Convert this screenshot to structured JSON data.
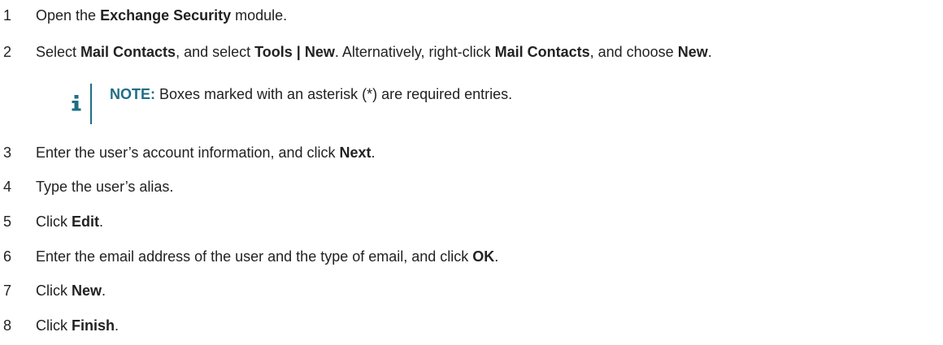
{
  "steps": [
    {
      "n": "1",
      "parts": [
        "Open the ",
        "Exchange Security",
        " module."
      ]
    },
    {
      "n": "2",
      "parts": [
        "Select ",
        "Mail Contacts",
        ", and select ",
        "Tools | New",
        ". Alternatively, right-click ",
        "Mail Contacts",
        ", and choose ",
        "New",
        "."
      ]
    },
    {
      "n": "3",
      "parts": [
        "Enter the user’s account information, and click ",
        "Next",
        "."
      ]
    },
    {
      "n": "4",
      "parts": [
        "Type the user’s alias."
      ]
    },
    {
      "n": "5",
      "parts": [
        "Click ",
        "Edit",
        "."
      ]
    },
    {
      "n": "6",
      "parts": [
        "Enter the email address of the user and the type of email, and click ",
        "OK",
        "."
      ]
    },
    {
      "n": "7",
      "parts": [
        "Click ",
        "New",
        "."
      ]
    },
    {
      "n": "8",
      "parts": [
        "Click ",
        "Finish",
        "."
      ]
    }
  ],
  "note": {
    "icon": "info-icon",
    "label": "NOTE:",
    "text": " Boxes marked with an asterisk (*) are required entries."
  },
  "colors": {
    "accent": "#1f6e86",
    "text": "#222222"
  }
}
